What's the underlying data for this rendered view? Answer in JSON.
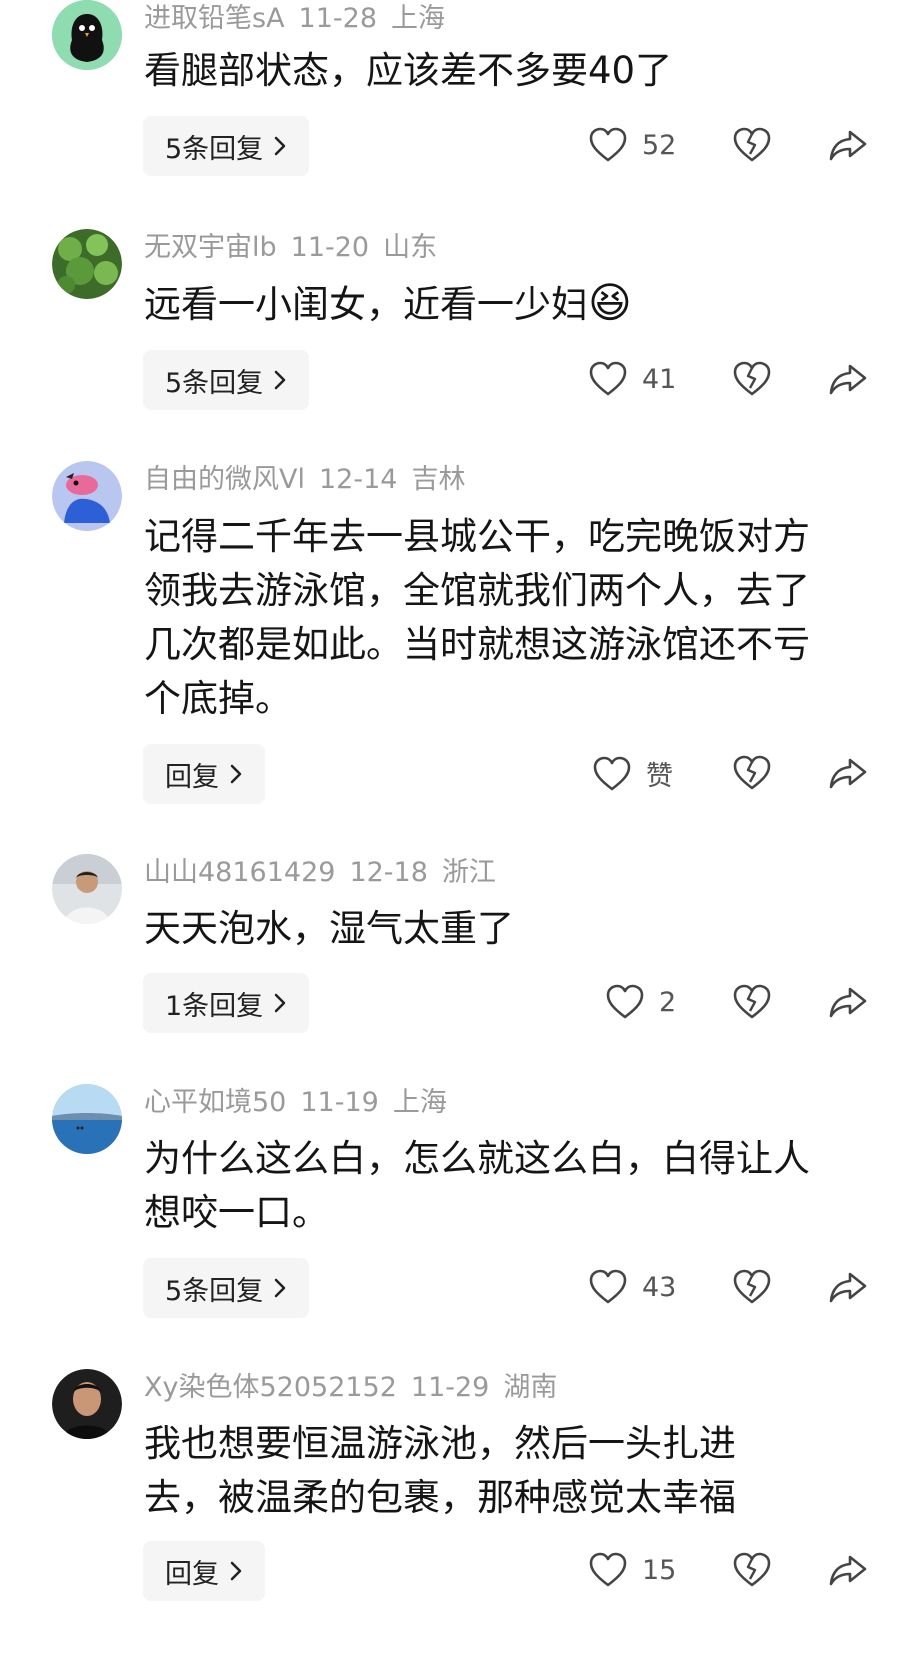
{
  "comments": [
    {
      "username": "进取铅笔sA",
      "date": "11-28",
      "location": "上海",
      "text": "看腿部状态，应该差不多要40了",
      "reply_label": "5条回复",
      "likes": "52",
      "avatar_icon": "black-bird-avatar"
    },
    {
      "username": "无双宇宙lb",
      "date": "11-20",
      "location": "山东",
      "text": "远看一小闺女，近看一少妇",
      "emoji": "😆",
      "reply_label": "5条回复",
      "likes": "41",
      "avatar_icon": "green-leaves-avatar"
    },
    {
      "username": "自由的微风Vl",
      "date": "12-14",
      "location": "吉林",
      "text": "记得二千年去一县城公干，吃完晚饭对方领我去游泳馆，全馆就我们两个人，去了几次都是如此。当时就想这游泳馆还不亏个底掉。",
      "reply_label": "回复",
      "likes": "赞",
      "avatar_icon": "cartoon-dino-avatar"
    },
    {
      "username": "山山48161429",
      "date": "12-18",
      "location": "浙江",
      "text": "天天泡水，湿气太重了",
      "reply_label": "1条回复",
      "likes": "2",
      "avatar_icon": "man-photo-avatar"
    },
    {
      "username": "心平如境50",
      "date": "11-19",
      "location": "上海",
      "text": "为什么这么白，怎么就这么白，白得让人想咬一口。",
      "reply_label": "5条回复",
      "likes": "43",
      "avatar_icon": "lake-photo-avatar"
    },
    {
      "username": "Xy染色体52052152",
      "date": "11-29",
      "location": "湖南",
      "text": "我也想要恒温游泳池，然后一头扎进去，被温柔的包裹，那种感觉太幸福",
      "reply_label": "回复",
      "likes": "15",
      "avatar_icon": "man-portrait-avatar"
    }
  ]
}
